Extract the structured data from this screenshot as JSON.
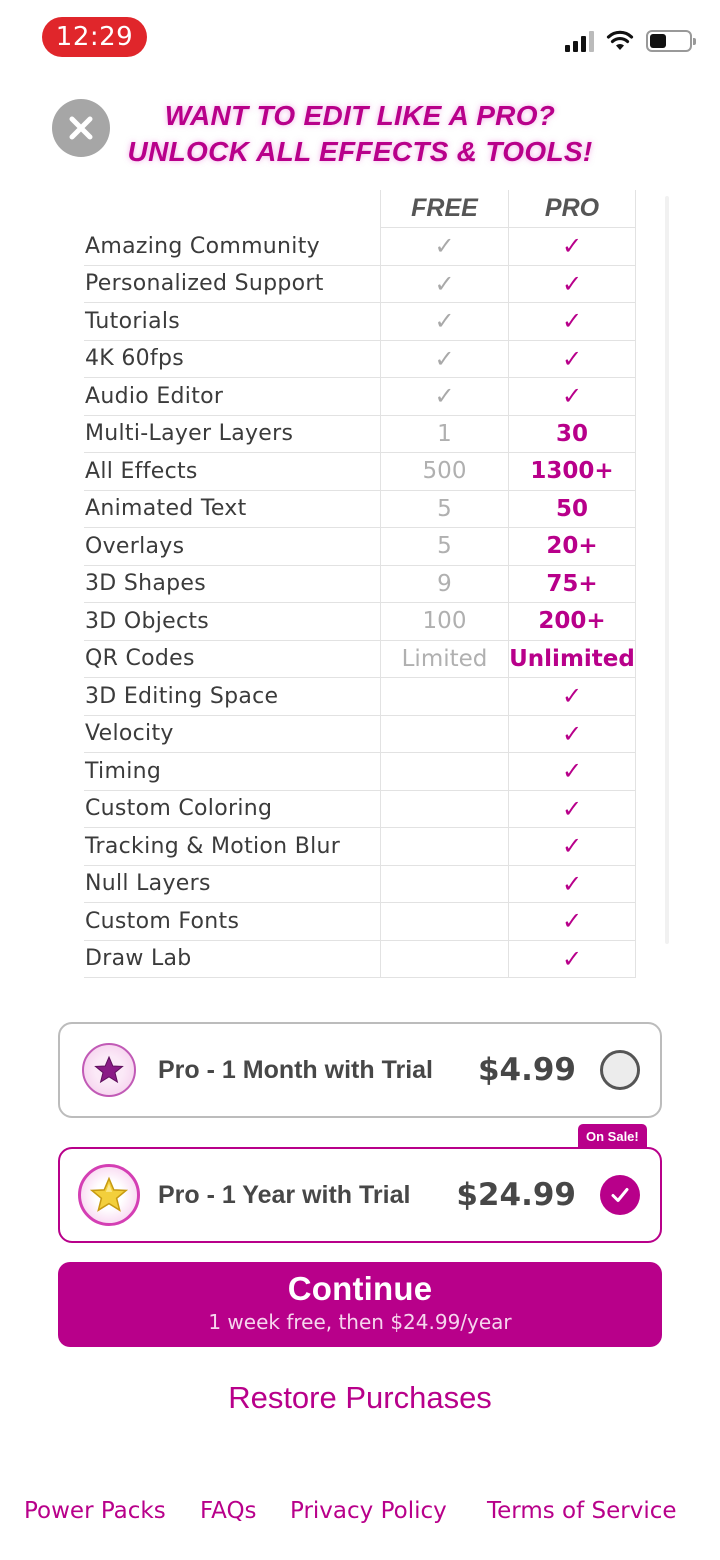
{
  "status_bar": {
    "time": "12:29"
  },
  "header": {
    "headline_line1": "WANT TO EDIT LIKE A PRO?",
    "headline_line2": "UNLOCK ALL EFFECTS & TOOLS!"
  },
  "comparison": {
    "columns": [
      "FREE",
      "PRO"
    ],
    "rows": [
      {
        "feature": "Amazing Community",
        "free": "✓",
        "pro": "✓"
      },
      {
        "feature": "Personalized Support",
        "free": "✓",
        "pro": "✓"
      },
      {
        "feature": "Tutorials",
        "free": "✓",
        "pro": "✓"
      },
      {
        "feature": "4K 60fps",
        "free": "✓",
        "pro": "✓"
      },
      {
        "feature": "Audio Editor",
        "free": "✓",
        "pro": "✓"
      },
      {
        "feature": "Multi-Layer Layers",
        "free": "1",
        "pro": "30"
      },
      {
        "feature": "All Effects",
        "free": "500",
        "pro": "1300+"
      },
      {
        "feature": "Animated Text",
        "free": "5",
        "pro": "50"
      },
      {
        "feature": "Overlays",
        "free": "5",
        "pro": "20+"
      },
      {
        "feature": "3D Shapes",
        "free": "9",
        "pro": "75+"
      },
      {
        "feature": "3D Objects",
        "free": "100",
        "pro": "200+"
      },
      {
        "feature": "QR Codes",
        "free": "Limited",
        "pro": "Unlimited"
      },
      {
        "feature": "3D Editing Space",
        "free": "",
        "pro": "✓"
      },
      {
        "feature": "Velocity",
        "free": "",
        "pro": "✓"
      },
      {
        "feature": "Timing",
        "free": "",
        "pro": "✓"
      },
      {
        "feature": "Custom Coloring",
        "free": "",
        "pro": "✓"
      },
      {
        "feature": "Tracking & Motion Blur",
        "free": "",
        "pro": "✓"
      },
      {
        "feature": "Null Layers",
        "free": "",
        "pro": "✓"
      },
      {
        "feature": "Custom Fonts",
        "free": "",
        "pro": "✓"
      },
      {
        "feature": "Draw Lab",
        "free": "",
        "pro": "✓"
      }
    ]
  },
  "plans": {
    "month": {
      "label": "Pro - 1 Month with Trial",
      "price": "$4.99",
      "selected": false,
      "icon": "purple-star-icon"
    },
    "year": {
      "label": "Pro - 1 Year with Trial",
      "price": "$24.99",
      "selected": true,
      "icon": "gold-star-icon",
      "badge": "On Sale!"
    }
  },
  "continue": {
    "title": "Continue",
    "subtitle": "1 week free, then $24.99/year"
  },
  "restore_label": "Restore Purchases",
  "footer_links": [
    "Power Packs",
    "FAQs",
    "Privacy Policy",
    "Terms of Service"
  ],
  "colors": {
    "accent": "#b8008a",
    "close": "#a6a6a6",
    "status_time_bg": "#e0262b"
  }
}
